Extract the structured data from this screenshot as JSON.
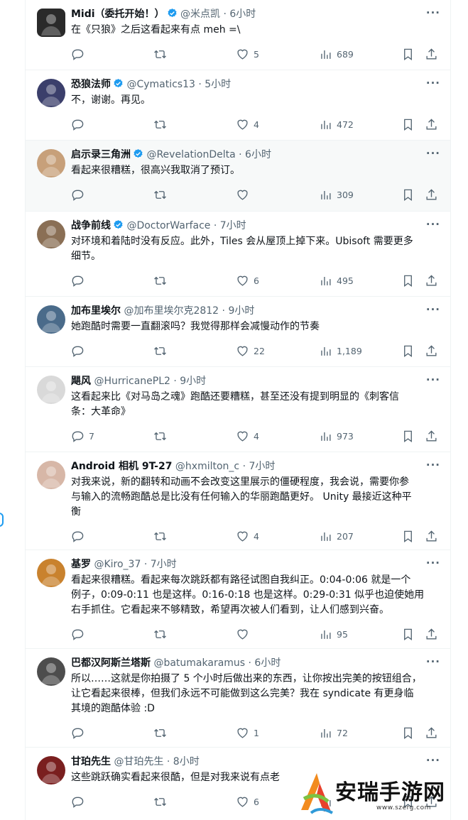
{
  "tweets": [
    {
      "name": "Midi（委托开始！）",
      "verified": true,
      "handle": "@米点凯",
      "time": "· 6小时",
      "text": "在《只狼》之后这看起来有点 meh =\\",
      "reply": "",
      "retweet": "",
      "like": "5",
      "views": "689",
      "avatar_color": "#2a2a2a"
    },
    {
      "name": "恐狼法师",
      "verified": true,
      "handle": "@Cymatics13",
      "time": "· 5小时",
      "text": "不，谢谢。再见。",
      "reply": "",
      "retweet": "",
      "like": "4",
      "views": "472",
      "avatar_color": "#3b3f6b"
    },
    {
      "name": "启示录三角洲",
      "verified": true,
      "handle": "@RevelationDelta",
      "time": "· 6小时",
      "text": "看起来很糟糕，很高兴我取消了预订。",
      "reply": "",
      "retweet": "",
      "like": "",
      "views": "309",
      "avatar_color": "#c7a07a"
    },
    {
      "name": "战争前线",
      "verified": true,
      "handle": "@DoctorWarface",
      "time": "· 7小时",
      "text": "对环境和着陆时没有反应。此外，Tiles 会从屋顶上掉下来。Ubisoft 需要更多\n细节。",
      "reply": "",
      "retweet": "",
      "like": "6",
      "views": "495",
      "avatar_color": "#8a6f55"
    },
    {
      "name": "加布里埃尔",
      "verified": false,
      "handle": "@加布里埃尔克2812",
      "time": "· 9小时",
      "text": "她跑酷时需要一直翻滚吗？我觉得那样会减慢动作的节奏",
      "reply": "",
      "retweet": "",
      "like": "22",
      "views": "1,189",
      "avatar_color": "#4a6b8a"
    },
    {
      "name": "飓风",
      "verified": false,
      "handle": "@HurricanePL2",
      "time": "· 9小时",
      "text": "这看起来比《对马岛之魂》跑酷还要糟糕，甚至还没有提到明显的《刺客信\n条：大革命》",
      "reply": "7",
      "retweet": "",
      "like": "4",
      "views": "973",
      "avatar_color": "#d9d9d9"
    },
    {
      "name": "Android 相机 9T-27",
      "verified": false,
      "handle": "@hxmilton_c",
      "time": "· 7小时",
      "text": "对我来说，新的翻转和动画不会改变这里展示的僵硬程度，我会说，需要你参\n与输入的流畅跑酷总是比没有任何输入的华丽跑酷更好。 Unity 最接近这种平\n衡",
      "reply": "",
      "retweet": "",
      "like": "4",
      "views": "207",
      "avatar_color": "#d7b7a7"
    },
    {
      "name": "基罗",
      "verified": false,
      "handle": "@Kiro_37",
      "time": "· 7小时",
      "text": "看起来很糟糕。看起来每次跳跃都有路径试图自我纠正。0:04-0:06 就是一个\n例子，0:09-0:11 也是这样。0:16-0:18 也是这样。0:29-0:31 似乎也迫使她用\n右手抓住。它看起来不够精致，希望再次被人们看到，让人们感到兴奋。",
      "reply": "",
      "retweet": "",
      "like": "",
      "views": "95",
      "avatar_color": "#c9822e"
    },
    {
      "name": "巴都汉阿斯兰塔斯",
      "verified": false,
      "handle": "@batumakaramus",
      "time": "· 6小时",
      "text": "所以……这就是你拍摄了 5 个小时后做出来的东西，让你按出完美的按钮组合，\n让它看起来很棒，但我们永远不可能做到这么完美？我在 syndicate 有更身临\n其境的跑酷体验 :D",
      "reply": "",
      "retweet": "",
      "like": "1",
      "views": "72",
      "avatar_color": "#4d4d4d"
    },
    {
      "name": "甘珀先生",
      "verified": false,
      "handle": "@甘珀先生",
      "time": "· 8小时",
      "text": "这些跳跃确实看起来很酷，但是对我来说有点老",
      "reply": "",
      "retweet": "",
      "like": "6",
      "views": "",
      "avatar_color": "#7a1f1f"
    }
  ],
  "watermark": {
    "title": "安瑞手游网",
    "url": "www.szerg.com"
  }
}
